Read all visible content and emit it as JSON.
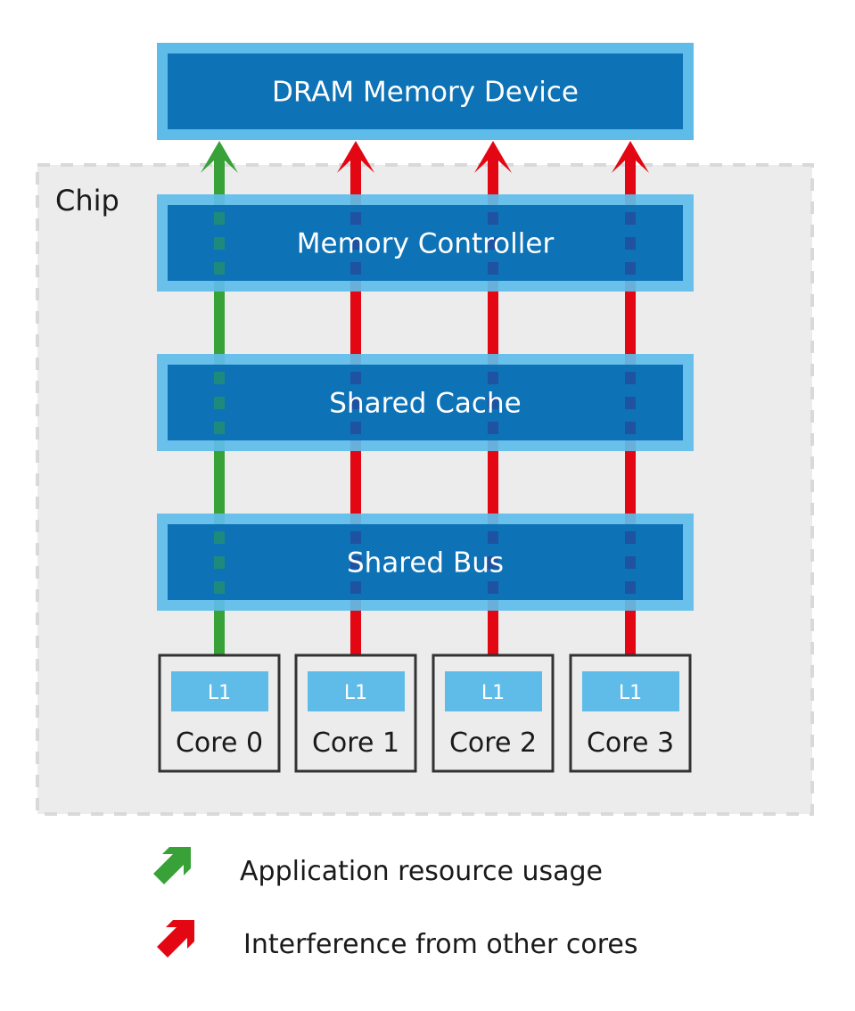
{
  "dram": {
    "label": "DRAM Memory Device"
  },
  "chip": {
    "label": "Chip"
  },
  "layers": [
    {
      "id": "memory-controller",
      "label": "Memory Controller"
    },
    {
      "id": "shared-cache",
      "label": "Shared Cache"
    },
    {
      "id": "shared-bus",
      "label": "Shared Bus"
    }
  ],
  "cores": [
    {
      "label": "Core 0",
      "cache": "L1",
      "flow": "application"
    },
    {
      "label": "Core 1",
      "cache": "L1",
      "flow": "interference"
    },
    {
      "label": "Core 2",
      "cache": "L1",
      "flow": "interference"
    },
    {
      "label": "Core 3",
      "cache": "L1",
      "flow": "interference"
    }
  ],
  "legend": [
    {
      "icon": "green-arrow-icon",
      "label": "Application resource usage",
      "kind": "application"
    },
    {
      "icon": "red-arrow-icon",
      "label": "Interference from other cores",
      "kind": "interference"
    }
  ],
  "colors": {
    "application": "#38a138",
    "interference": "#e30613",
    "box_outer": "#5fbce9",
    "box_inner": "#0e72b6",
    "chip_bg": "#ececec",
    "chip_border": "#d9d9d9",
    "core_border": "#333333",
    "text_dark": "#1a1a1a",
    "text_light": "#ffffff"
  }
}
